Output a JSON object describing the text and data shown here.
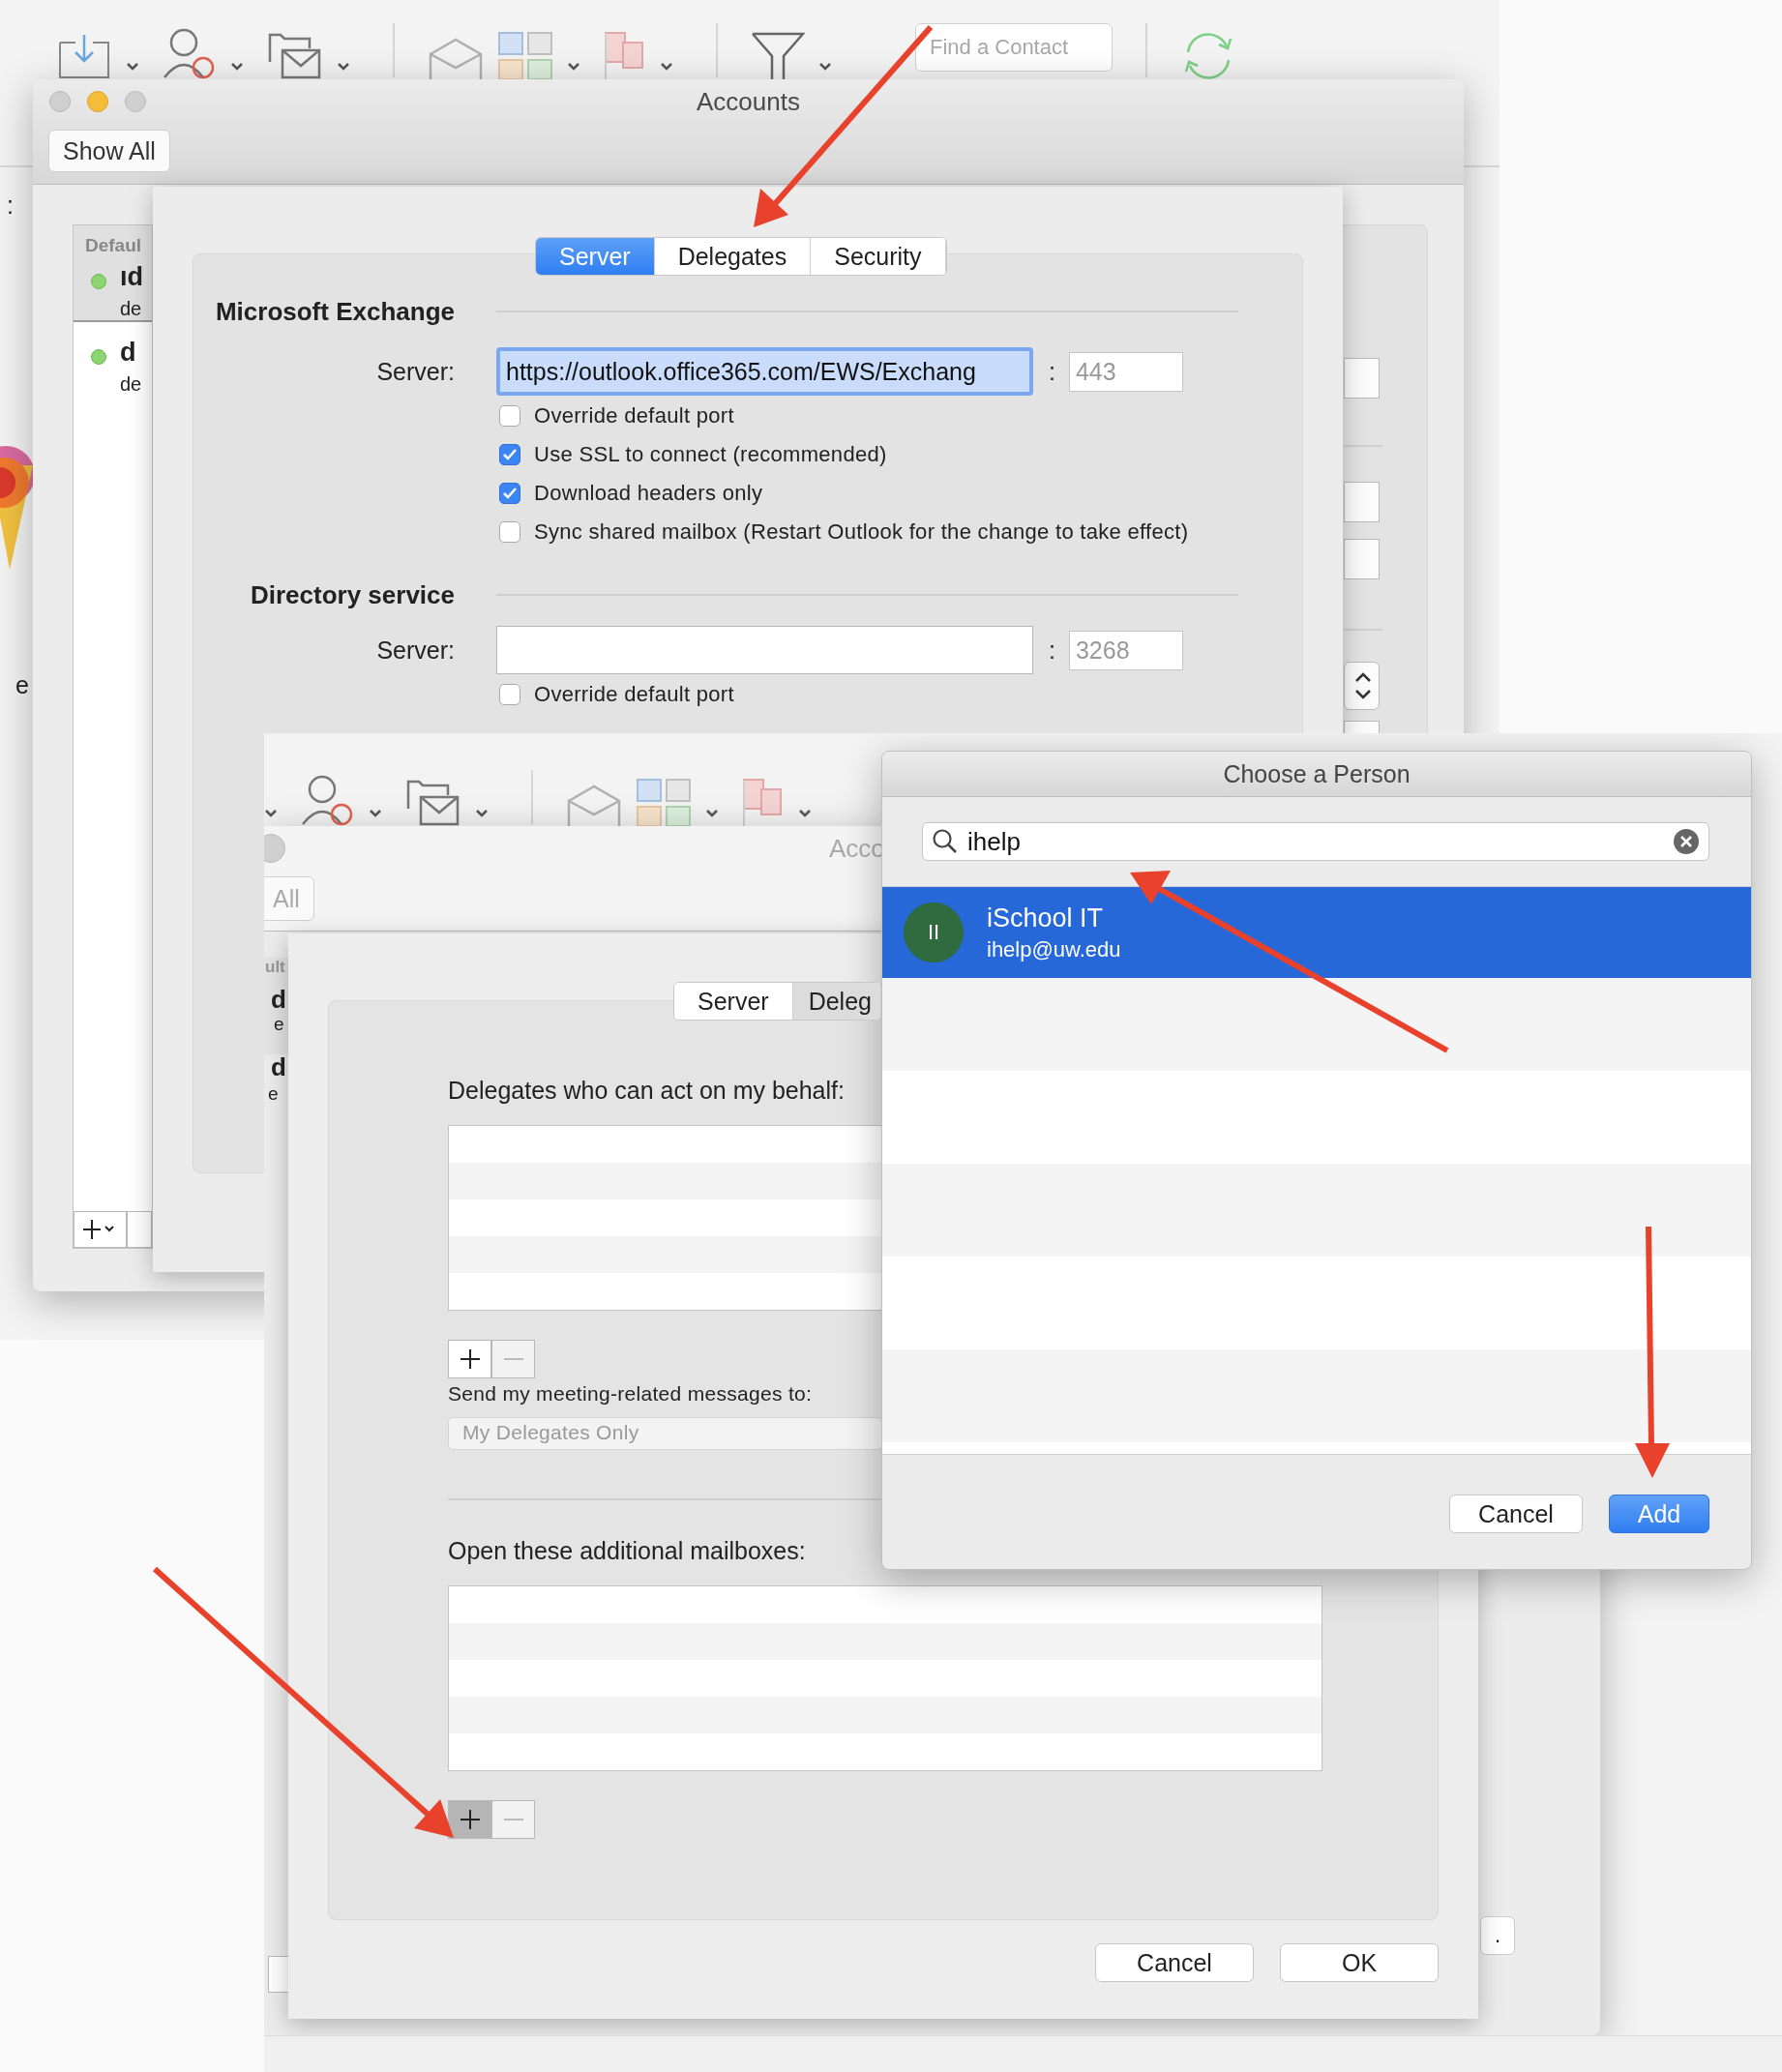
{
  "background_app": {
    "search_placeholder": "Find a Contact",
    "edge_texts": [
      ":",
      "e"
    ]
  },
  "accounts_window": {
    "title": "Accounts",
    "show_all_button": "Show All",
    "sidebar": {
      "header": "Defaul",
      "accounts": [
        {
          "name": "ıd",
          "detail": "de",
          "selected": true
        },
        {
          "name": "d",
          "detail": "de",
          "selected": false
        }
      ]
    },
    "tabs": [
      {
        "label": "Server",
        "selected": true
      },
      {
        "label": "Delegates",
        "selected": false
      },
      {
        "label": "Security",
        "selected": false
      }
    ],
    "sections": [
      {
        "heading": "Microsoft Exchange",
        "server_label": "Server:",
        "server_value": "https://outlook.office365.com/EWS/Exchang",
        "separator": ":",
        "port_placeholder": "443",
        "options": [
          {
            "label": "Override default port",
            "checked": false
          },
          {
            "label": "Use SSL to connect (recommended)",
            "checked": true
          },
          {
            "label": "Download headers only",
            "checked": true
          },
          {
            "label": "Sync shared mailbox (Restart Outlook for the change to take effect)",
            "checked": false
          }
        ]
      },
      {
        "heading": "Directory service",
        "server_label": "Server:",
        "separator": ":",
        "port_placeholder": "3268",
        "options": [
          {
            "label": "Override default port",
            "checked": false
          }
        ]
      }
    ]
  },
  "accounts_window_2": {
    "title": "Acco",
    "show_all_button": "All",
    "sidebar_fragments": [
      "ult",
      "d",
      "e",
      "d",
      "e"
    ],
    "tabs": [
      {
        "label": "Server",
        "selected": false
      },
      {
        "label": "Deleg",
        "selected": true
      }
    ],
    "delegates": {
      "label": "Delegates who can act on my behalf:",
      "add_pressed": false
    },
    "meeting": {
      "label": "Send my meeting-related messages to:",
      "value": "My Delegates Only",
      "disabled": true
    },
    "mailboxes": {
      "label": "Open these additional mailboxes:",
      "add_pressed": true
    },
    "buttons": [
      "Cancel",
      "OK"
    ],
    "side_button": "."
  },
  "choose_person": {
    "title": "Choose a Person",
    "search": {
      "value": "ihelp"
    },
    "results": [
      {
        "initials": "II",
        "name": "iSchool IT",
        "email": "ihelp@uw.edu",
        "selected": true
      }
    ],
    "buttons": [
      {
        "label": "Cancel",
        "default": false
      },
      {
        "label": "Add",
        "default": true
      }
    ]
  }
}
